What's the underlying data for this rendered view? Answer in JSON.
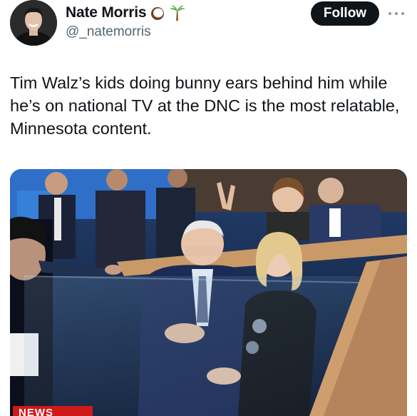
{
  "author": {
    "display_name": "Nate Morris",
    "handle": "@_natemorris",
    "name_emojis": [
      "coconut-emoji",
      "palm-tree-emoji"
    ]
  },
  "actions": {
    "follow_label": "Follow",
    "more_icon": "more-horizontal-icon"
  },
  "tweet": {
    "text": "Tim Walz’s kids doing bunny ears behind him while he’s on national TV at the DNC is the most relatable, Minnesota content."
  },
  "media": {
    "news_banner": "NEWS"
  },
  "colors": {
    "text_primary": "#0f1419",
    "text_secondary": "#536471",
    "follow_bg": "#0f1419",
    "news_red": "#d01a1a"
  }
}
